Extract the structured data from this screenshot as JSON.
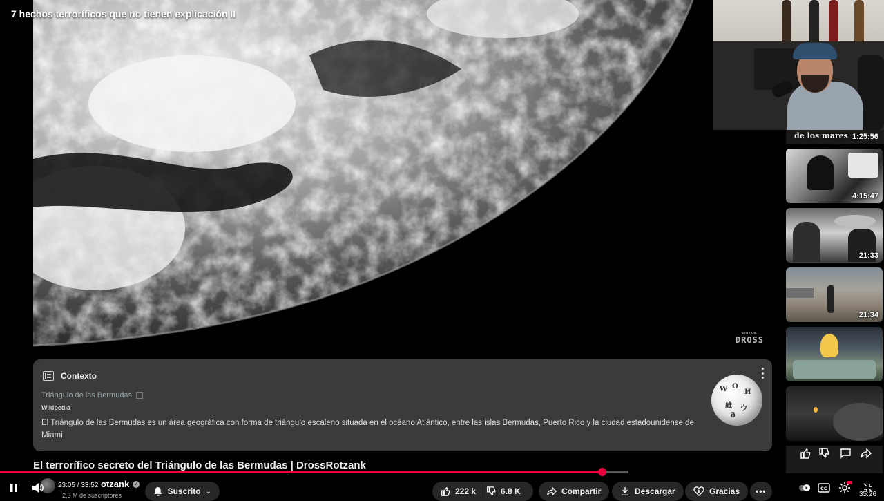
{
  "top_title": "7 hechos terroríficos que no tienen explicación II",
  "video_frame": {
    "watermark_line1": "DROSS",
    "watermark_line2": "ROTZANK"
  },
  "suggested": [
    {
      "caption": "de los mares",
      "duration": "1:25:56"
    },
    {
      "duration": "4:15:47"
    },
    {
      "duration": "21:33"
    },
    {
      "duration": "21:34"
    },
    {
      "duration": ""
    },
    {
      "duration": ""
    }
  ],
  "context": {
    "header": "Contexto",
    "source_title": "Triángulo de las Bermudas",
    "provider": "Wikipedia",
    "description": "El Triángulo de las Bermudas es un área geográfica con forma de triángulo escaleno situada en el océano Atlántico, entre las islas Bermudas, Puerto Rico y la ciudad estadounidense de Miami."
  },
  "video": {
    "title": "El terrorífico secreto del Triángulo de las Bermudas | DrossRotzank",
    "channel": "DrossRotzank",
    "channel_visible": "otzank",
    "subscribers": "2,3 M de suscriptores",
    "current_time": "23:05",
    "total_time": "33:52",
    "time_display": "23:05 / 33:52",
    "progress_fraction": 0.681,
    "buffered_fraction": 0.711
  },
  "actions": {
    "subscribe_label": "Suscrito",
    "likes": "222 k",
    "dislikes": "6.8 K",
    "share_label": "Compartir",
    "download_label": "Descargar",
    "thanks_label": "Gracias"
  },
  "corner_time": "35:26",
  "colors": {
    "accent": "#e8003f",
    "panel_bg": "#3b3b3b",
    "pill_bg": "#272727"
  }
}
